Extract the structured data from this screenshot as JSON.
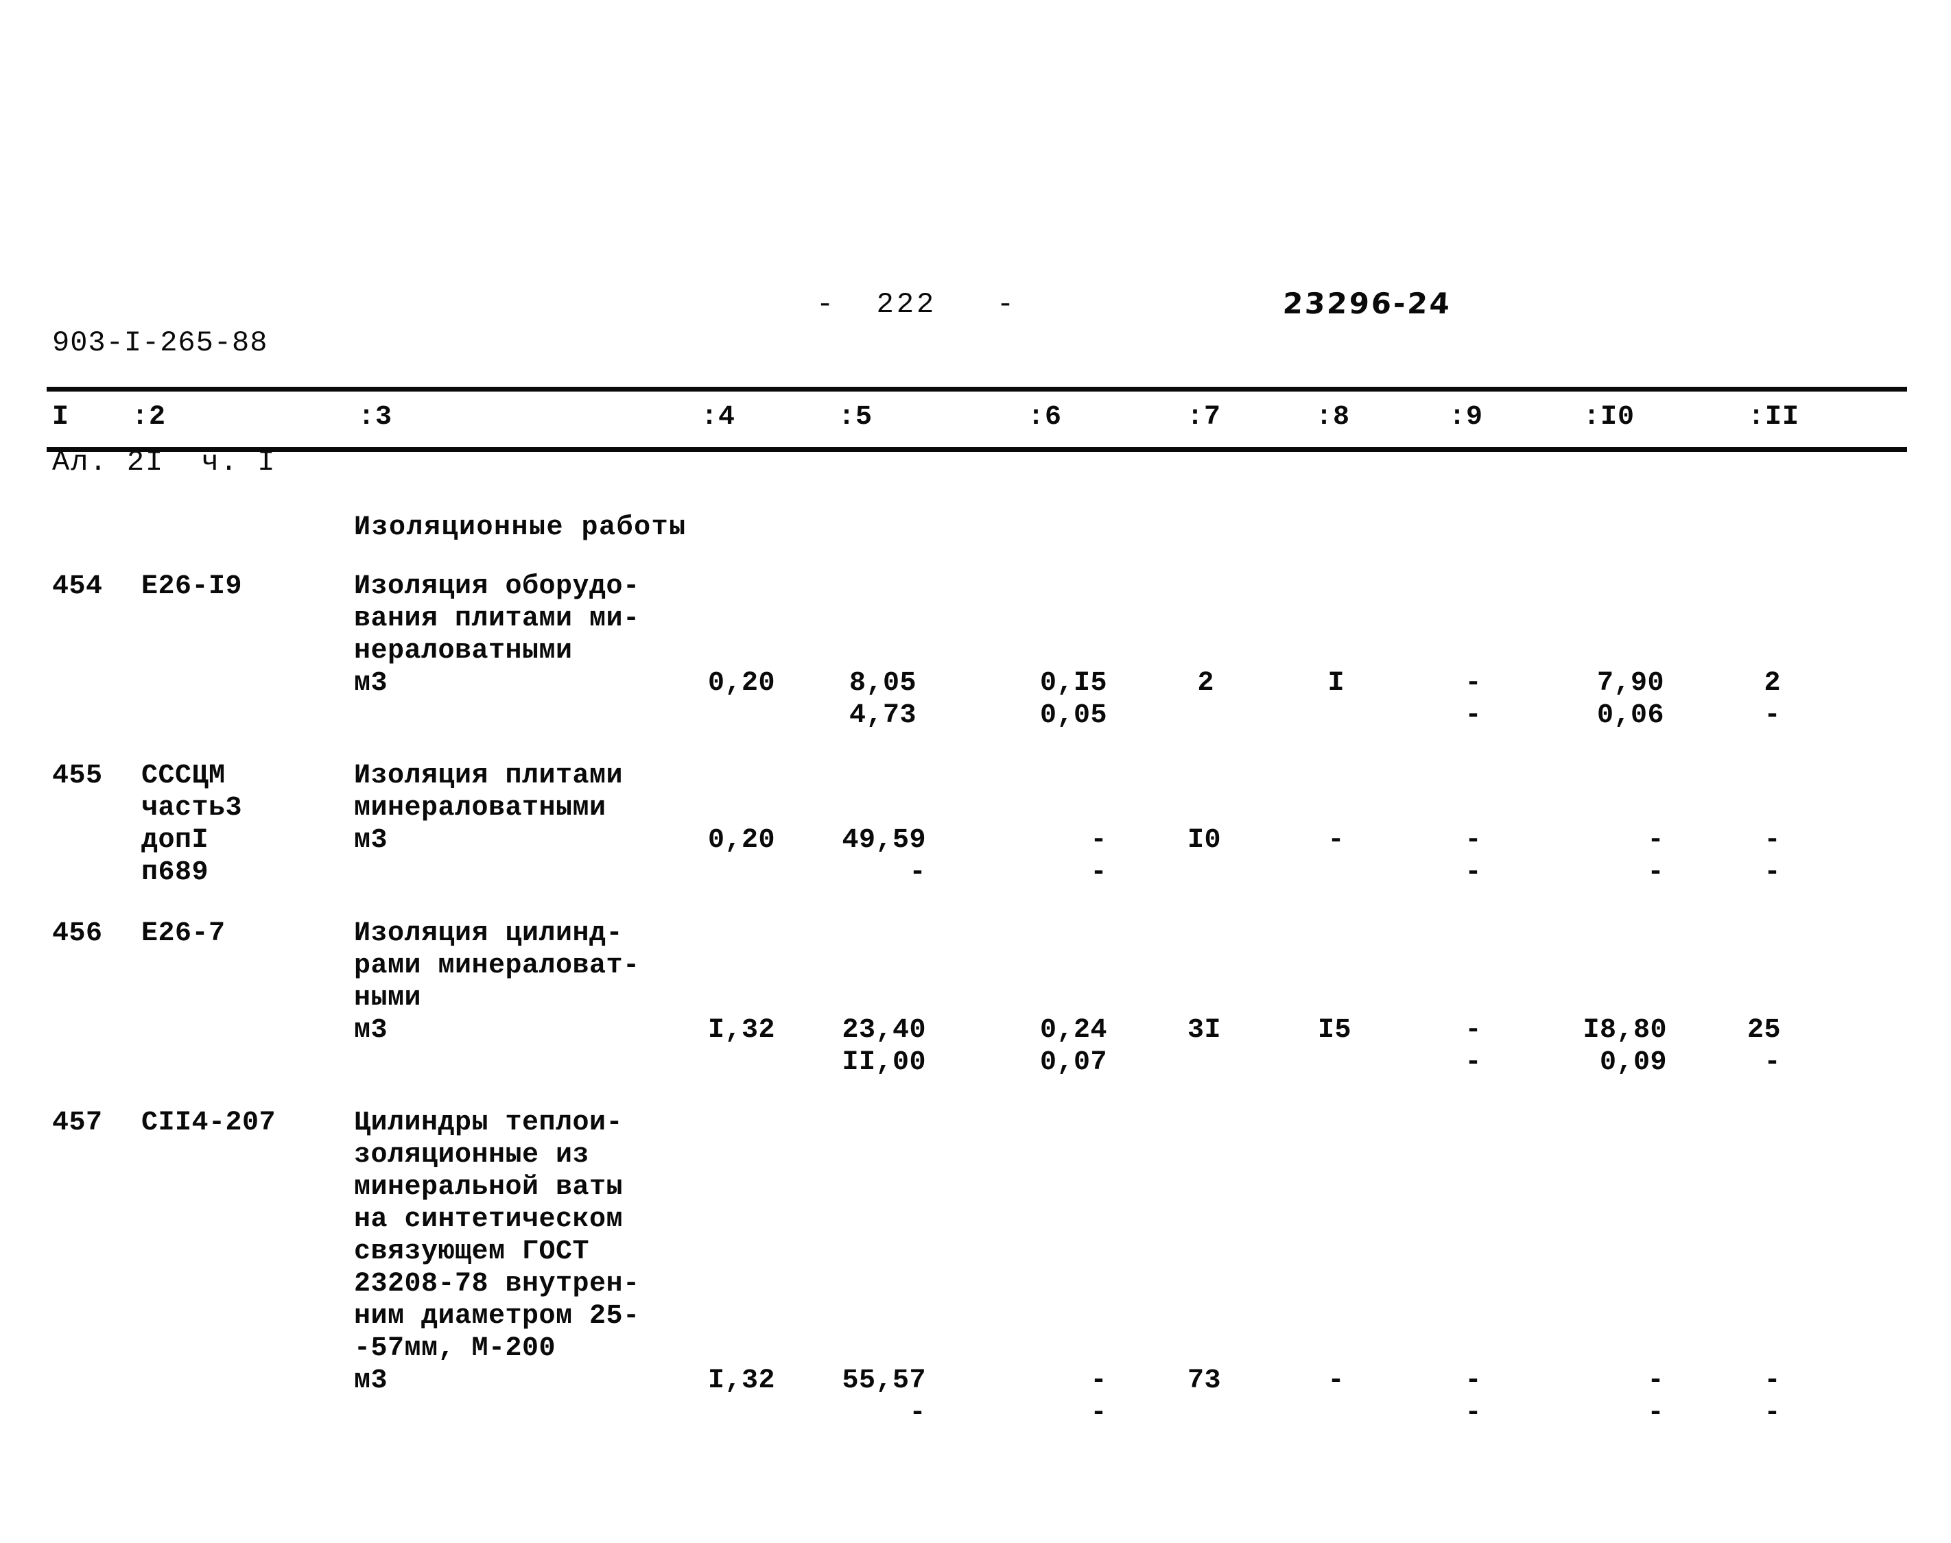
{
  "header": {
    "doc_code_line1": "903-I-265-88",
    "doc_code_line2": "Ал. 2I  ч. I",
    "page_marker": "-  222   -",
    "doc_ref": "23296-24"
  },
  "table": {
    "columns": [
      "I",
      ":2",
      ":3",
      ":4",
      ":5",
      ":6",
      ":7",
      ":8",
      ":9",
      ":I0",
      ":II"
    ],
    "section_title": "Изоляционные работы",
    "rows": [
      {
        "num": "454",
        "code": "Е26-I9",
        "description": "Изоляция оборудо-\nвания плитами ми-\nнераловатными\nм3",
        "c4": "0,20",
        "c5_top": "8,05",
        "c5_bot": "4,73",
        "c6_top": "0,I5",
        "c6_bot": "0,05",
        "c7": "2",
        "c8": "I",
        "c9_top": "-",
        "c9_bot": "-",
        "c10_top": "7,90",
        "c10_bot": "0,06",
        "c11_top": "2",
        "c11_bot": "-"
      },
      {
        "num": "455",
        "code": "СССЦМ\nчасть3\nдопI\nп689",
        "description": "Изоляция плитами\nминераловатными\nм3",
        "c4": "0,20",
        "c5_top": "49,59",
        "c5_bot": "-",
        "c6_top": "-",
        "c6_bot": "-",
        "c7": "I0",
        "c8": "-",
        "c9_top": "-",
        "c9_bot": "-",
        "c10_top": "-",
        "c10_bot": "-",
        "c11_top": "-",
        "c11_bot": "-"
      },
      {
        "num": "456",
        "code": "Е26-7",
        "description": "Изоляция цилинд-\nрами минераловат-\nными\nм3",
        "c4": "I,32",
        "c5_top": "23,40",
        "c5_bot": "II,00",
        "c6_top": "0,24",
        "c6_bot": "0,07",
        "c7": "3I",
        "c8": "I5",
        "c9_top": "-",
        "c9_bot": "-",
        "c10_top": "I8,80",
        "c10_bot": "0,09",
        "c11_top": "25",
        "c11_bot": "-"
      },
      {
        "num": "457",
        "code": "СII4-207",
        "description": "Цилиндры теплои-\nзоляционные из\nминеральной ваты\nна синтетическом\nсвязующем ГОСТ\n23208-78 внутрен-\nним диаметром 25-\n-57мм, М-200\nм3",
        "c4": "I,32",
        "c5_top": "55,57",
        "c5_bot": "-",
        "c6_top": "-",
        "c6_bot": "-",
        "c7": "73",
        "c8": "-",
        "c9_top": "-",
        "c9_bot": "-",
        "c10_top": "-",
        "c10_bot": "-",
        "c11_top": "-",
        "c11_bot": "-"
      }
    ]
  }
}
